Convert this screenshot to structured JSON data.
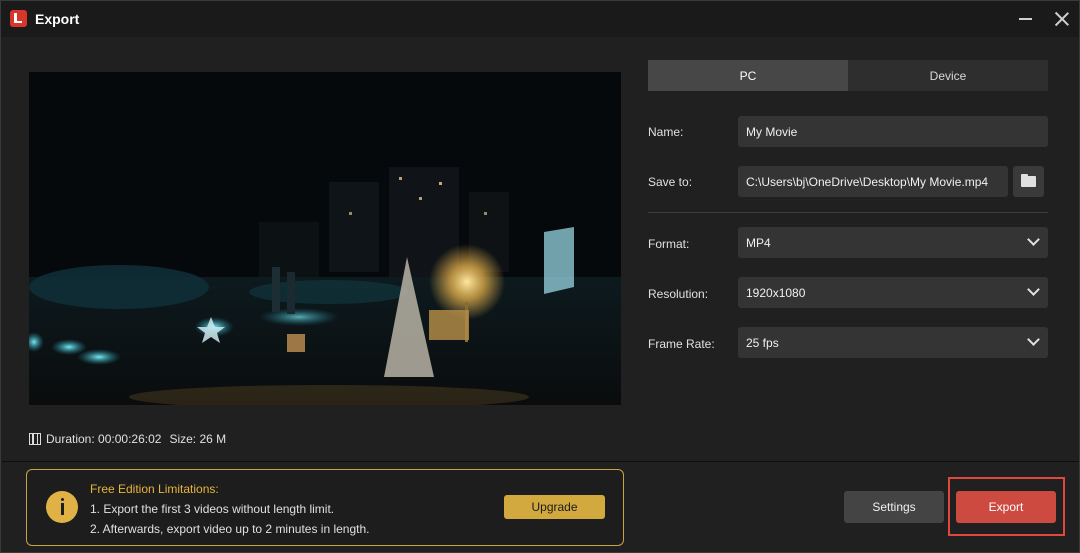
{
  "window": {
    "title": "Export"
  },
  "preview": {
    "duration_label": "Duration:",
    "duration_value": "00:00:26:02",
    "size_label": "Size:",
    "size_value": "26 M"
  },
  "tabs": [
    {
      "label": "PC",
      "active": true
    },
    {
      "label": "Device",
      "active": false
    }
  ],
  "form": {
    "name_label": "Name:",
    "name_value": "My Movie",
    "save_label": "Save to:",
    "save_value": "C:\\Users\\bj\\OneDrive\\Desktop\\My Movie.mp4",
    "format_label": "Format:",
    "format_value": "MP4",
    "resolution_label": "Resolution:",
    "resolution_value": "1920x1080",
    "framerate_label": "Frame Rate:",
    "framerate_value": "25 fps"
  },
  "limitations": {
    "title": "Free Edition Limitations:",
    "line1": "1. Export the first 3 videos without length limit.",
    "line2": "2. Afterwards, export video up to 2 minutes in length.",
    "upgrade_label": "Upgrade"
  },
  "actions": {
    "settings_label": "Settings",
    "export_label": "Export"
  },
  "colors": {
    "accent_red": "#cd4a40",
    "highlight_frame": "#e0473d",
    "gold": "#d1a93f"
  },
  "icons": [
    "app-logo-icon",
    "minimize-icon",
    "close-icon",
    "film-icon",
    "folder-icon",
    "chevron-down-icon",
    "info-icon"
  ]
}
